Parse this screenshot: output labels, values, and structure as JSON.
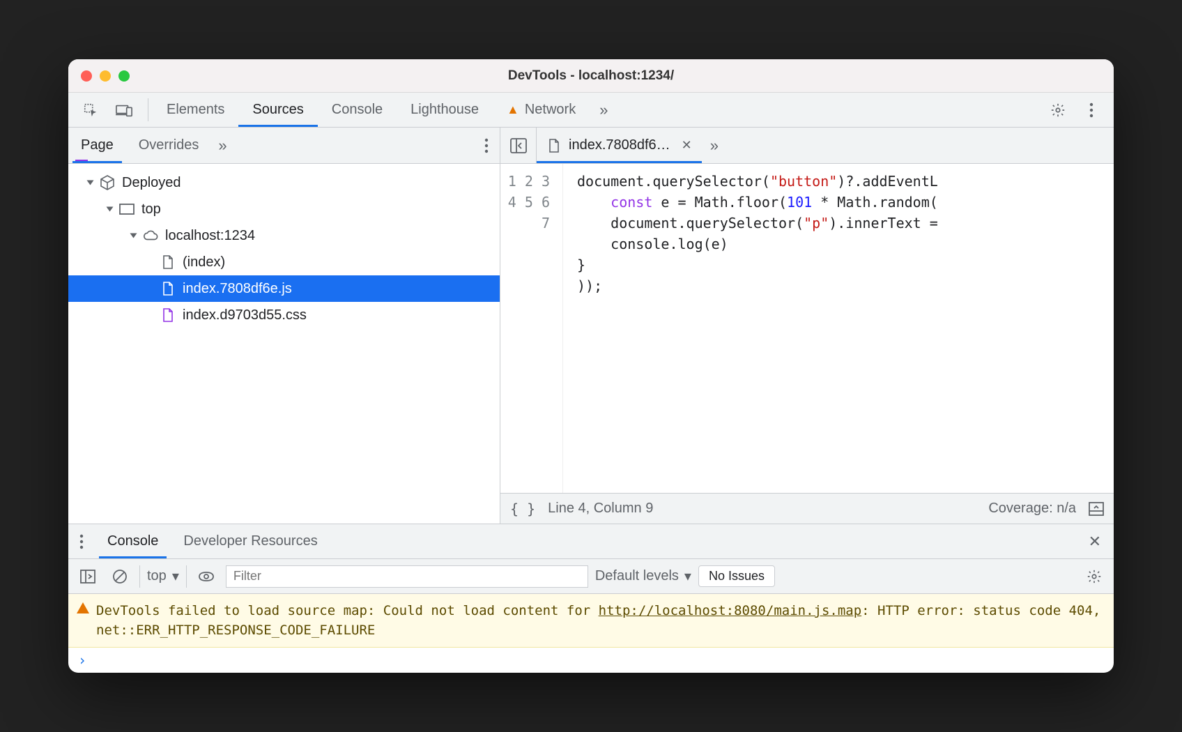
{
  "window": {
    "title": "DevTools - localhost:1234/"
  },
  "tabs": {
    "items": [
      "Elements",
      "Sources",
      "Console",
      "Lighthouse",
      "Network"
    ],
    "active": "Sources",
    "network_has_warning": true
  },
  "sources": {
    "navigator_tabs": [
      "Page",
      "Overrides"
    ],
    "navigator_active": "Page",
    "tree": {
      "root": "Deployed",
      "top": "top",
      "host": "localhost:1234",
      "files": [
        {
          "name": "(index)",
          "kind": "document",
          "selected": false
        },
        {
          "name": "index.7808df6e.js",
          "kind": "script",
          "selected": true
        },
        {
          "name": "index.d9703d55.css",
          "kind": "stylesheet",
          "selected": false
        }
      ]
    },
    "open_tab": {
      "label": "index.7808df6…"
    },
    "code": {
      "lines": [
        "document.querySelector(\"button\")?.addEventL",
        "    const e = Math.floor(101 * Math.random(",
        "    document.querySelector(\"p\").innerText =",
        "    console.log(e)",
        "}",
        "));",
        ""
      ]
    },
    "status": {
      "cursor": "Line 4, Column 9",
      "coverage": "Coverage: n/a"
    }
  },
  "drawer": {
    "tabs": [
      "Console",
      "Developer Resources"
    ],
    "active": "Console"
  },
  "console": {
    "context": "top",
    "filter_placeholder": "Filter",
    "levels": "Default levels",
    "issues": "No Issues",
    "warning": {
      "prefix": "DevTools failed to load source map: Could not load content for ",
      "url": "http://localhost:8080/main.js.map",
      "suffix": ": HTTP error: status code 404, net::ERR_HTTP_RESPONSE_CODE_FAILURE"
    }
  }
}
